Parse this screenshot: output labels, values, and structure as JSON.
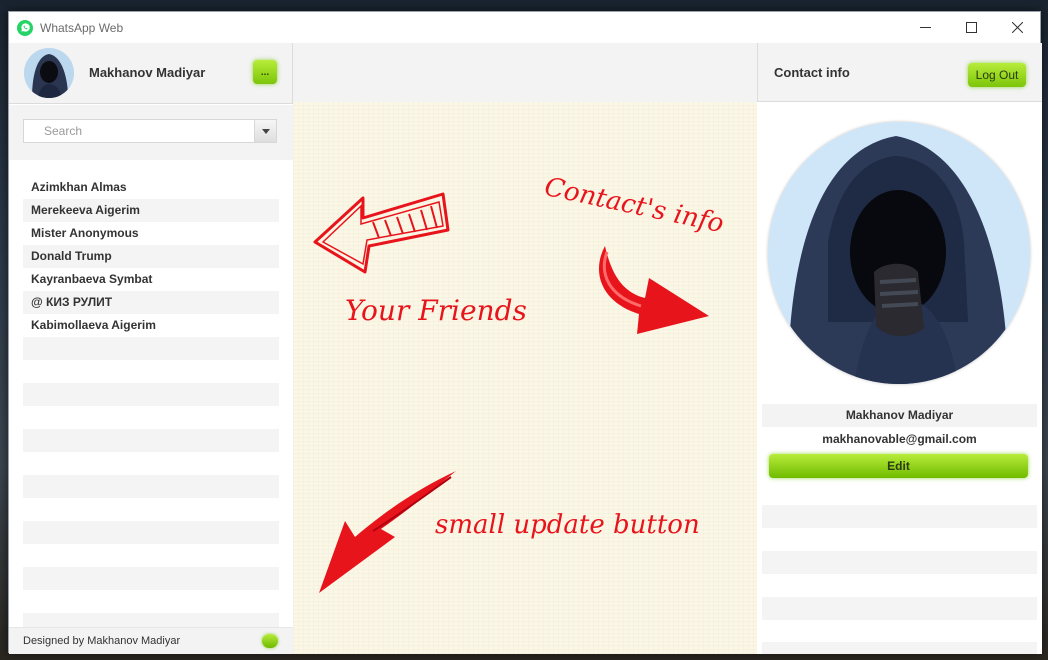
{
  "window": {
    "title": "WhatsApp Web"
  },
  "profile": {
    "name": "Makhanov Madiyar",
    "menu_label": "..."
  },
  "search": {
    "placeholder": "Search"
  },
  "friends": [
    "Azimkhan Almas",
    "Merekeeva Aigerim",
    "Mister Anonymous",
    "Donald Trump",
    "Kayranbaeva Symbat",
    "@ КИЗ РУЛИТ",
    "Kabimollaeva Aigerim"
  ],
  "footer": {
    "designed_by": "Designed by Makhanov Madiyar"
  },
  "annotations": {
    "friends": "Your Friends",
    "contact_info": "Contact's info",
    "update_button": "small update button"
  },
  "contact": {
    "header_title": "Contact info",
    "logout_label": "Log Out",
    "name": "Makhanov Madiyar",
    "email": "makhanovable@gmail.com",
    "edit_label": "Edit"
  },
  "colors": {
    "accent_green": "#8fd412",
    "annotation_red": "#e8141c",
    "whatsapp_green": "#25d366"
  }
}
